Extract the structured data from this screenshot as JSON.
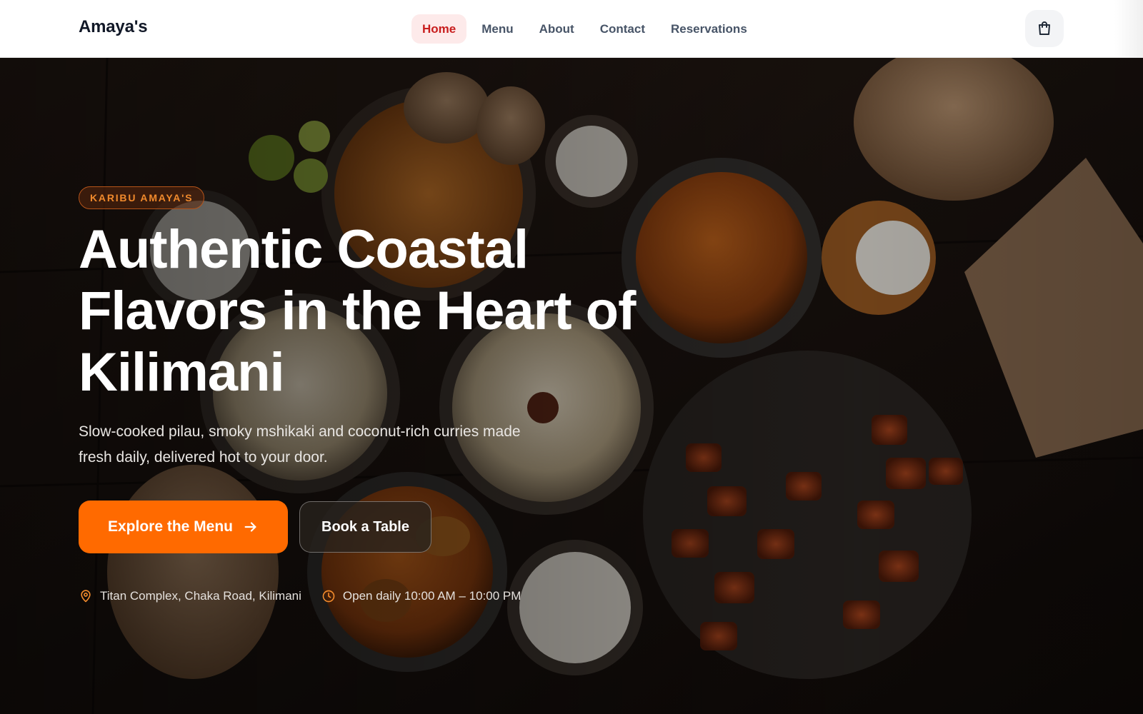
{
  "header": {
    "brand": "Amaya's",
    "nav": [
      {
        "label": "Home",
        "active": true
      },
      {
        "label": "Menu",
        "active": false
      },
      {
        "label": "About",
        "active": false
      },
      {
        "label": "Contact",
        "active": false
      },
      {
        "label": "Reservations",
        "active": false
      }
    ],
    "cart_icon": "shopping-bag-icon"
  },
  "hero": {
    "badge": "KARIBU AMAYA'S",
    "title": "Authentic Coastal Flavors in the Heart of Kilimani",
    "subtitle": "Slow-cooked pilau, smoky mshikaki and coconut-rich curries made fresh daily, delivered hot to your door.",
    "primary_cta": "Explore the Menu",
    "primary_cta_icon": "arrow-right-icon",
    "secondary_cta": "Book a Table",
    "location": "Titan Complex, Chaka Road, Kilimani",
    "location_icon": "map-pin-icon",
    "hours": "Open daily 10:00 AM – 10:00 PM",
    "hours_icon": "clock-icon",
    "background_image": "overhead dishes: pilau rice bowls, curry, skewers, chapati"
  },
  "colors": {
    "accent": "#ff6a00",
    "active_nav": "#c81e1e",
    "active_nav_bg": "#fdeaea",
    "badge_text": "#f08a2c"
  }
}
